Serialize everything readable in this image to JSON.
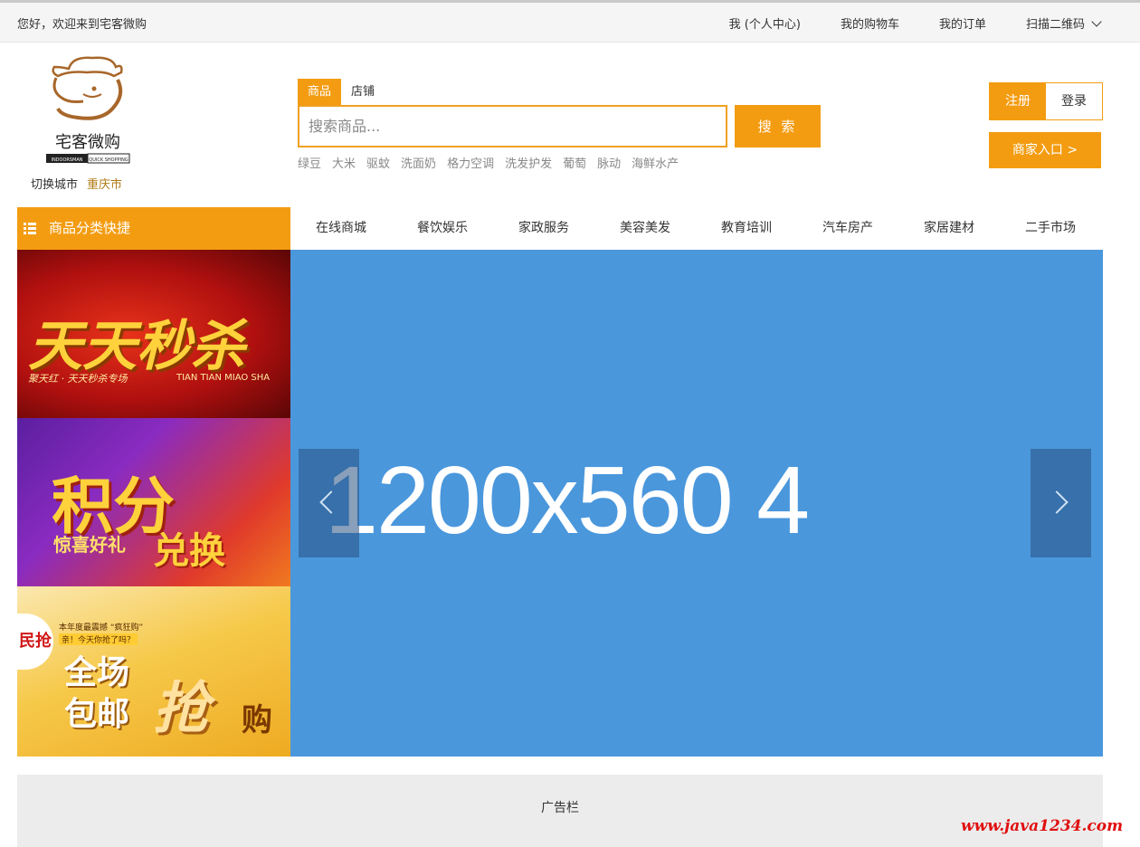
{
  "topbar": {
    "welcome": "您好，欢迎来到宅客微购",
    "links": [
      "我 (个人中心)",
      "我的购物车",
      "我的订单",
      "扫描二维码"
    ]
  },
  "brand": {
    "name": "宅客微购",
    "tagline_en_1": "INDOORSMAN",
    "tagline_en_2": "QUICK SHOPPING",
    "colors": {
      "accent": "#f39c12",
      "logo": "#a8672a"
    }
  },
  "city": {
    "label": "切换城市",
    "current": "重庆市"
  },
  "search": {
    "tabs": [
      "商品",
      "店铺"
    ],
    "active_tab": "商品",
    "placeholder": "搜索商品...",
    "button": "搜 索",
    "hot": [
      "绿豆",
      "大米",
      "驱蚊",
      "洗面奶",
      "格力空调",
      "洗发护发",
      "葡萄",
      "脉动",
      "海鲜水产"
    ]
  },
  "auth": {
    "register": "注册",
    "login": "登录",
    "merchant": "商家入口 >"
  },
  "category": {
    "label": "商品分类快捷",
    "icon": "list-icon"
  },
  "nav": [
    "在线商城",
    "餐饮娱乐",
    "家政服务",
    "美容美发",
    "教育培训",
    "汽车房产",
    "家居建材",
    "二手市场"
  ],
  "promos": {
    "p1": {
      "title": "天天秒杀",
      "sub": "聚天红 · 天天秒杀专场",
      "sub_en": "TIAN TIAN MIAO SHA"
    },
    "p2": {
      "title": "积分",
      "line2a": "惊喜好礼",
      "line2b": "兑换"
    },
    "p3": {
      "tag": "民抢",
      "small1": "本年度最震撼 “疯狂购”",
      "small2": "亲！今天你抢了吗？",
      "line1": "全场",
      "line2": "包邮",
      "big": "抢",
      "end": "购"
    }
  },
  "slider": {
    "text": "1200x560 4",
    "bg": "#4a97dc"
  },
  "adbar": {
    "label": "广告栏"
  },
  "watermark": "www.java1234.com"
}
